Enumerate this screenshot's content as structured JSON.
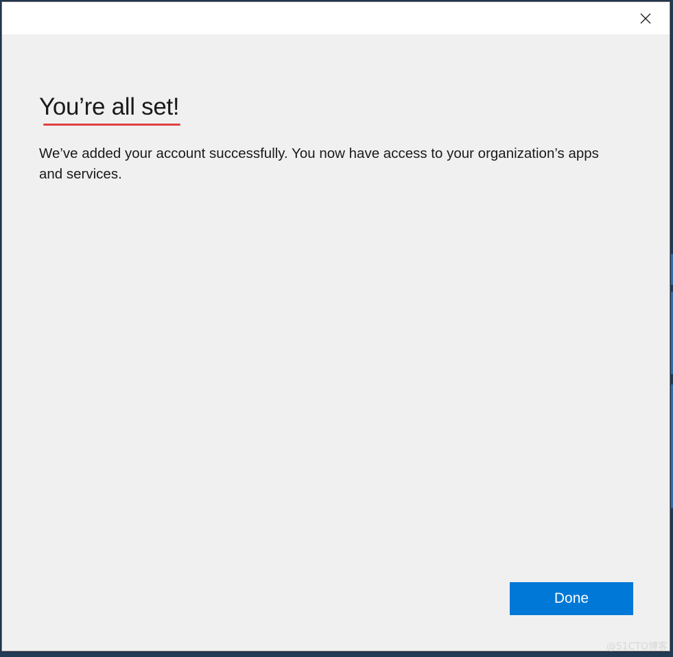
{
  "dialog": {
    "close_icon": "close-icon",
    "heading": "You’re all set!",
    "message": "We’ve added your account successfully. You now have access to your organization’s apps and services.",
    "done_label": "Done",
    "accent_color": "#0078d7",
    "underline_color": "#e04040"
  },
  "watermark": {
    "text": "@51CTO博客"
  }
}
